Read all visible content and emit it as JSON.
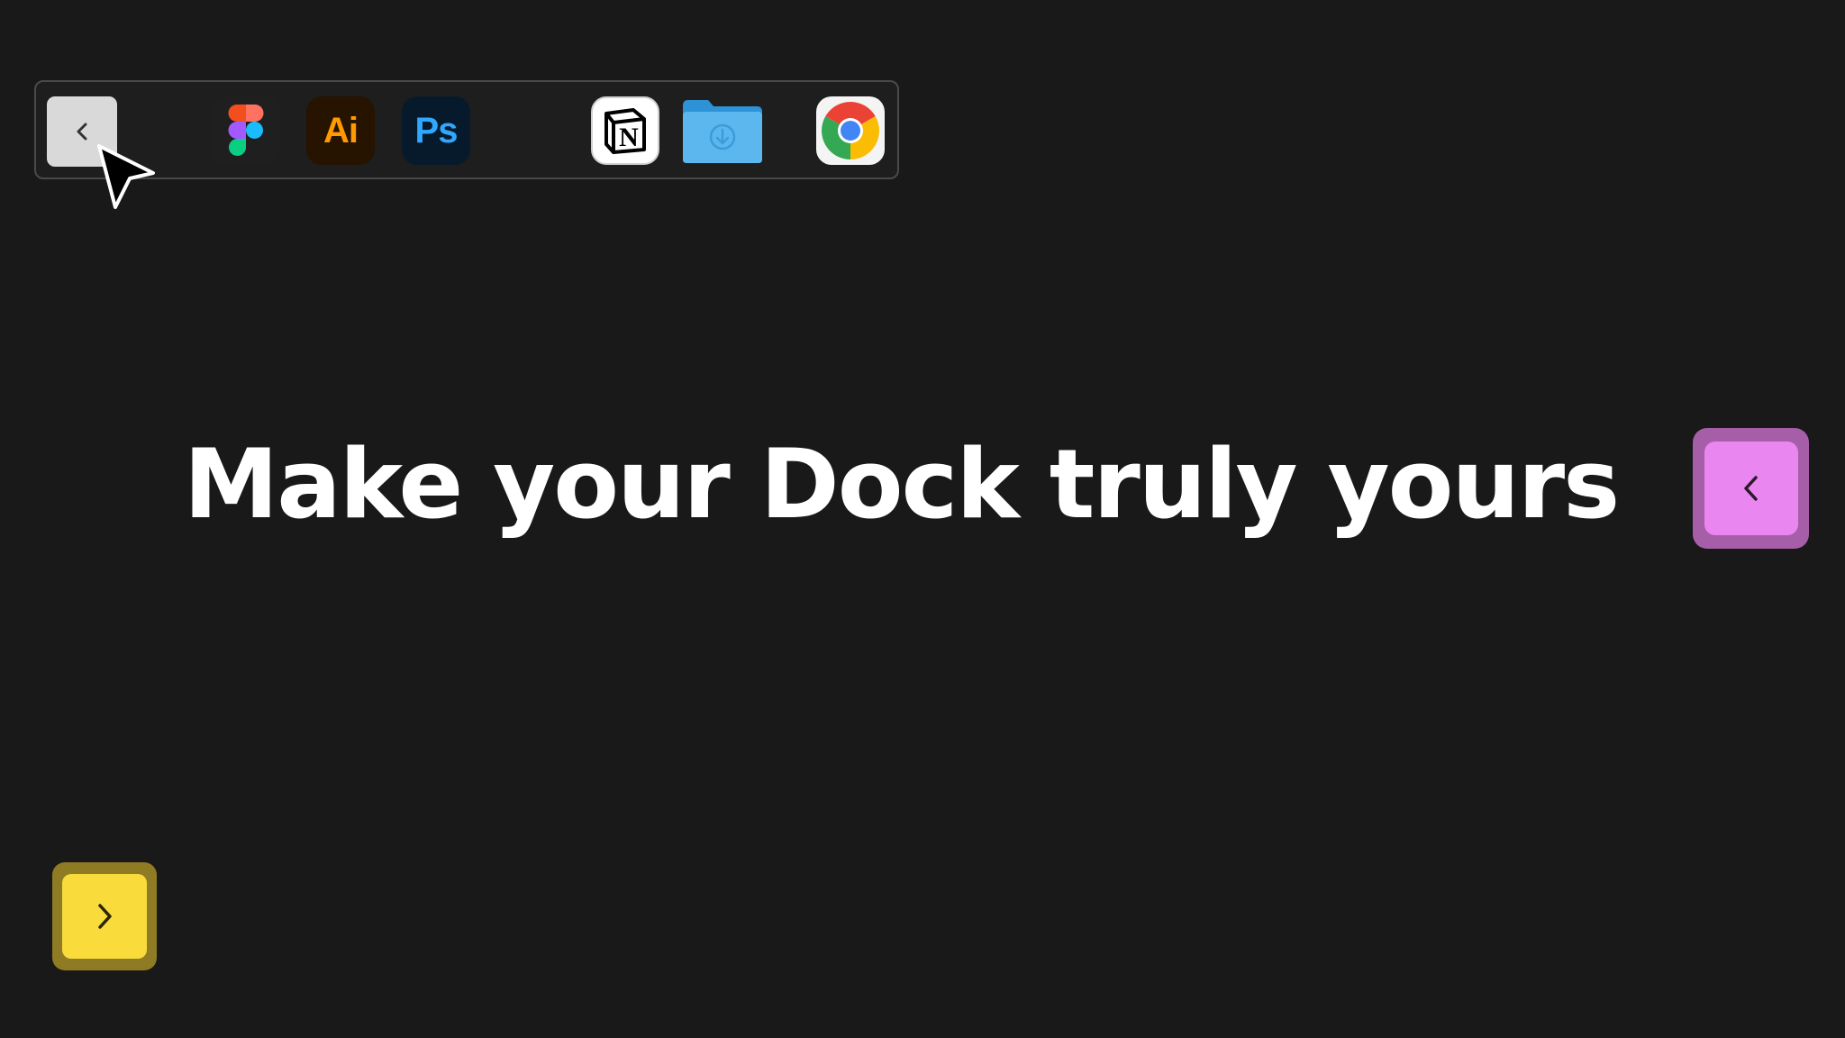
{
  "headline": "Make your Dock truly yours",
  "dock": {
    "collapse_icon": "chevron-left-icon",
    "apps": [
      {
        "name": "Figma",
        "icon": "figma-icon"
      },
      {
        "name": "Illustrator",
        "icon": "illustrator-icon",
        "label": "Ai"
      },
      {
        "name": "Photoshop",
        "icon": "photoshop-icon",
        "label": "Ps"
      },
      {
        "name": "Notion",
        "icon": "notion-icon",
        "label": "N"
      },
      {
        "name": "Downloads",
        "icon": "downloads-folder-icon"
      },
      {
        "name": "Chrome",
        "icon": "chrome-icon"
      }
    ]
  },
  "keys": {
    "pink": {
      "icon": "chevron-left-icon",
      "color": "#ea86f0"
    },
    "yellow": {
      "icon": "chevron-right-icon",
      "color": "#f9dc3c"
    }
  },
  "colors": {
    "background": "#191919",
    "text": "#ffffff"
  }
}
